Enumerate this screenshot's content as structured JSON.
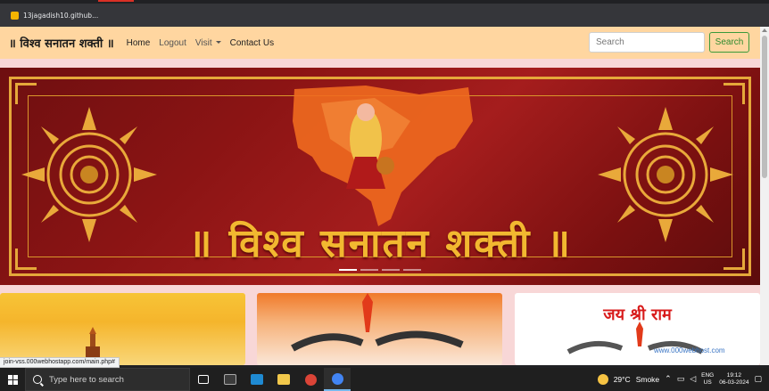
{
  "browser": {
    "bookmark_label": "13jagadish10.github...",
    "status_url": "join-vss.000webhostapp.com/main.php#"
  },
  "navbar": {
    "brand": "॥ विश्व सनातन शक्ती ॥",
    "links": [
      "Home",
      "Logout",
      "Visit",
      "Contact Us"
    ],
    "search_placeholder": "Search",
    "search_button": "Search"
  },
  "banner": {
    "title": "॥ विश्व सनातन शक्ती ॥",
    "slide_count": 4,
    "active_slide": 1
  },
  "cards": {
    "card3_title": "जय श्री राम",
    "card3_watermark": "www.000webhost.com"
  },
  "taskbar": {
    "search_text": "Type here to search",
    "temperature": "29°C",
    "weather": "Smoke",
    "language": "ENG",
    "region": "US",
    "time": "19:12",
    "date": "06-03-2024"
  },
  "colors": {
    "navbar_bg": "#ffd6a0",
    "page_bg": "#f8d7d7",
    "banner_red": "#8b1414",
    "banner_gold": "#f2b830",
    "search_green": "#2e8b2e"
  }
}
